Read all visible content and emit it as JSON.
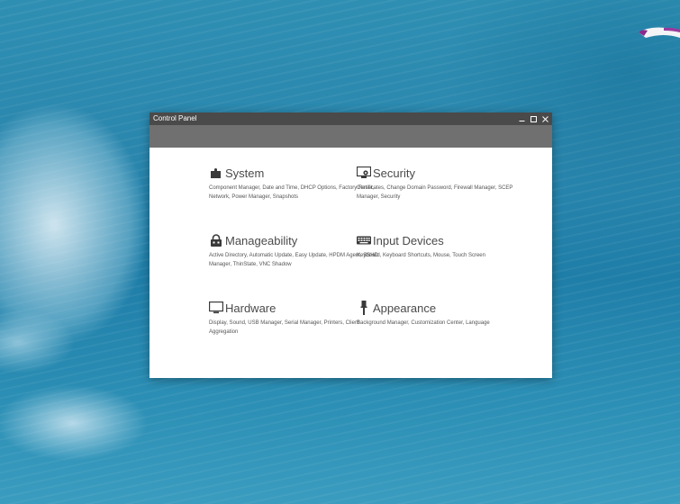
{
  "window": {
    "title": "Control Panel",
    "controls": {
      "minimize_icon": "minimize-icon",
      "maximize_icon": "maximize-icon",
      "close_icon": "close-icon"
    }
  },
  "categories": [
    {
      "id": "system",
      "title": "System",
      "icon": "puzzle-icon",
      "description": "Component Manager, Date and Time, DHCP Options, Factory Reset, Network, Power Manager, Snapshots"
    },
    {
      "id": "security",
      "title": "Security",
      "icon": "monitor-lock-icon",
      "description": "Certificates, Change Domain Password, Firewall Manager, SCEP Manager, Security"
    },
    {
      "id": "manageability",
      "title": "Manageability",
      "icon": "robot-icon",
      "description": "Active Directory, Automatic Update, Easy Update, HPDM Agent, SSHD Manager, ThinState, VNC Shadow"
    },
    {
      "id": "input-devices",
      "title": "Input Devices",
      "icon": "keyboard-icon",
      "description": "Keyboard, Keyboard Shortcuts, Mouse, Touch Screen"
    },
    {
      "id": "hardware",
      "title": "Hardware",
      "icon": "monitor-icon",
      "description": "Display, Sound, USB Manager, Serial Manager, Printers, Client Aggregation"
    },
    {
      "id": "appearance",
      "title": "Appearance",
      "icon": "paint-brush-icon",
      "description": "Background Manager, Customization Center, Language"
    }
  ],
  "colors": {
    "titlebar": "#4a4a4a",
    "subheader": "#707070",
    "category_title": "#4a4a4a",
    "description_text": "#555555"
  }
}
